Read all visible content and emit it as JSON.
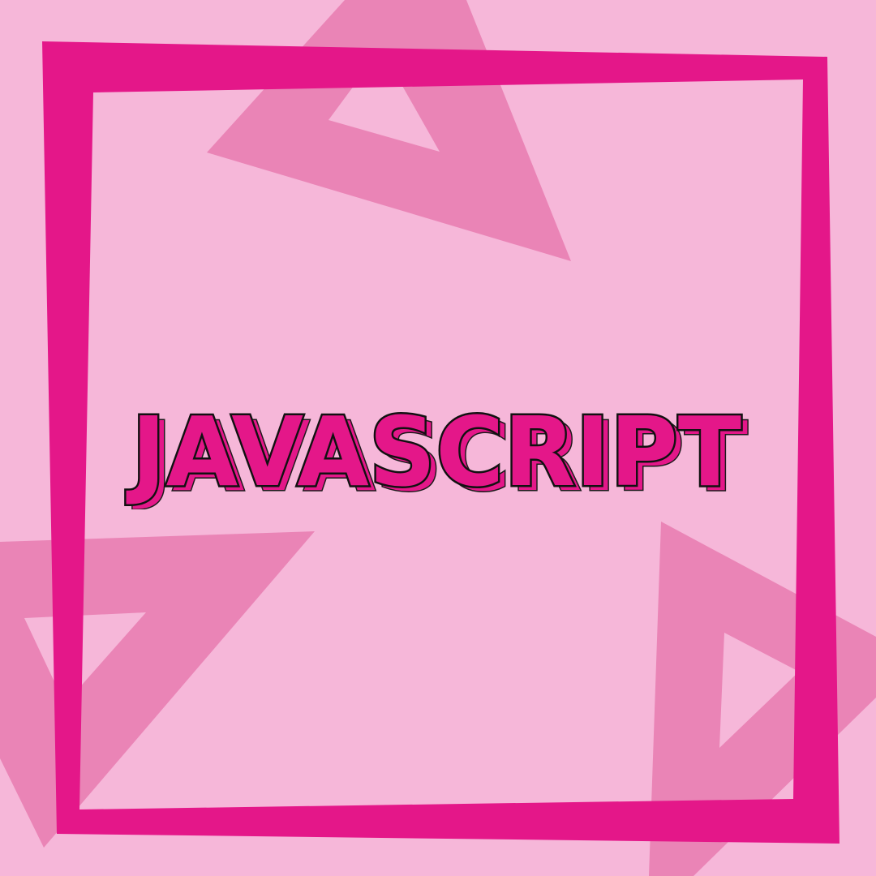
{
  "title": {
    "text": "JAVASCRIPT"
  },
  "colors": {
    "background": "#f6b7d9",
    "triangle": "#ea84b6",
    "frame": "#e41789",
    "text_fill": "#e41789",
    "text_stroke": "#111111",
    "text_shadow": "#e41789"
  },
  "icons": {
    "decorative_shape": "triangle-outline"
  }
}
